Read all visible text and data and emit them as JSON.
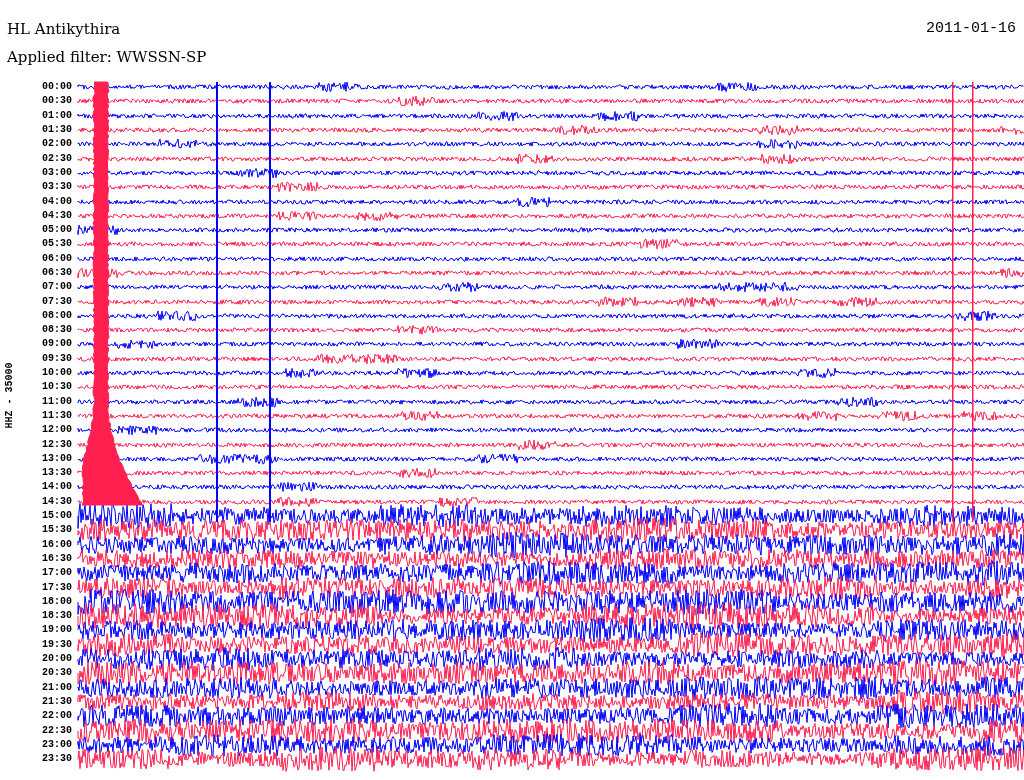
{
  "header": {
    "station": "HL Antikythira",
    "date": "2011-01-16",
    "filter": "Applied filter: WWSSN-SP"
  },
  "axis_label": "HHZ - 35000",
  "rows": [
    {
      "time": "00:00",
      "color": "#0000ff"
    },
    {
      "time": "00:30",
      "color": "#ff2050"
    },
    {
      "time": "01:00",
      "color": "#0000ff"
    },
    {
      "time": "01:30",
      "color": "#ff2050"
    },
    {
      "time": "02:00",
      "color": "#0000ff"
    },
    {
      "time": "02:30",
      "color": "#ff2050"
    },
    {
      "time": "03:00",
      "color": "#0000ff"
    },
    {
      "time": "03:30",
      "color": "#ff2050"
    },
    {
      "time": "04:00",
      "color": "#0000ff"
    },
    {
      "time": "04:30",
      "color": "#ff2050"
    },
    {
      "time": "05:00",
      "color": "#0000ff"
    },
    {
      "time": "05:30",
      "color": "#ff2050"
    },
    {
      "time": "06:00",
      "color": "#0000ff"
    },
    {
      "time": "06:30",
      "color": "#ff2050"
    },
    {
      "time": "07:00",
      "color": "#0000ff"
    },
    {
      "time": "07:30",
      "color": "#ff2050"
    },
    {
      "time": "08:00",
      "color": "#0000ff"
    },
    {
      "time": "08:30",
      "color": "#ff2050"
    },
    {
      "time": "09:00",
      "color": "#0000ff"
    },
    {
      "time": "09:30",
      "color": "#ff2050"
    },
    {
      "time": "10:00",
      "color": "#0000ff"
    },
    {
      "time": "10:30",
      "color": "#ff2050"
    },
    {
      "time": "11:00",
      "color": "#0000ff"
    },
    {
      "time": "11:30",
      "color": "#ff2050"
    },
    {
      "time": "12:00",
      "color": "#0000ff"
    },
    {
      "time": "12:30",
      "color": "#ff2050"
    },
    {
      "time": "13:00",
      "color": "#0000ff"
    },
    {
      "time": "13:30",
      "color": "#ff2050"
    },
    {
      "time": "14:00",
      "color": "#0000ff"
    },
    {
      "time": "14:30",
      "color": "#ff2050"
    },
    {
      "time": "15:00",
      "color": "#0000ff"
    },
    {
      "time": "15:30",
      "color": "#ff2050"
    },
    {
      "time": "16:00",
      "color": "#0000ff"
    },
    {
      "time": "16:30",
      "color": "#ff2050"
    },
    {
      "time": "17:00",
      "color": "#0000ff"
    },
    {
      "time": "17:30",
      "color": "#ff2050"
    },
    {
      "time": "18:00",
      "color": "#0000ff"
    },
    {
      "time": "18:30",
      "color": "#ff2050"
    },
    {
      "time": "19:00",
      "color": "#0000ff"
    },
    {
      "time": "19:30",
      "color": "#ff2050"
    },
    {
      "time": "20:00",
      "color": "#0000ff"
    },
    {
      "time": "20:30",
      "color": "#ff2050"
    },
    {
      "time": "21:00",
      "color": "#0000ff"
    },
    {
      "time": "21:30",
      "color": "#ff2050"
    },
    {
      "time": "22:00",
      "color": "#0000ff"
    },
    {
      "time": "22:30",
      "color": "#ff2050"
    },
    {
      "time": "23:00",
      "color": "#0000ff"
    },
    {
      "time": "23:30",
      "color": "#ff2050"
    }
  ]
}
